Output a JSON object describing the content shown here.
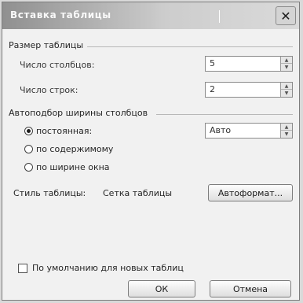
{
  "dialog": {
    "title": "Вставка таблицы",
    "close_glyph": "✕"
  },
  "size_group": {
    "label": "Размер таблицы",
    "columns_label": "Число столбцов:",
    "columns_value": "5",
    "rows_label": "Число строк:",
    "rows_value": "2",
    "spin_up": "▲",
    "spin_down": "▼"
  },
  "autofit_group": {
    "label": "Автоподбор ширины столбцов",
    "options": [
      {
        "label": "постоянная:",
        "selected": true
      },
      {
        "label": "по содержимому",
        "selected": false
      },
      {
        "label": "по ширине окна",
        "selected": false
      }
    ],
    "fixed_width_value": "Авто"
  },
  "style": {
    "label": "Стиль таблицы:",
    "value": "Сетка таблицы",
    "autoformat_button": "Автоформат..."
  },
  "default_checkbox": {
    "label": "По умолчанию для новых таблиц",
    "checked": false
  },
  "buttons": {
    "ok": "ОК",
    "cancel": "Отмена"
  }
}
